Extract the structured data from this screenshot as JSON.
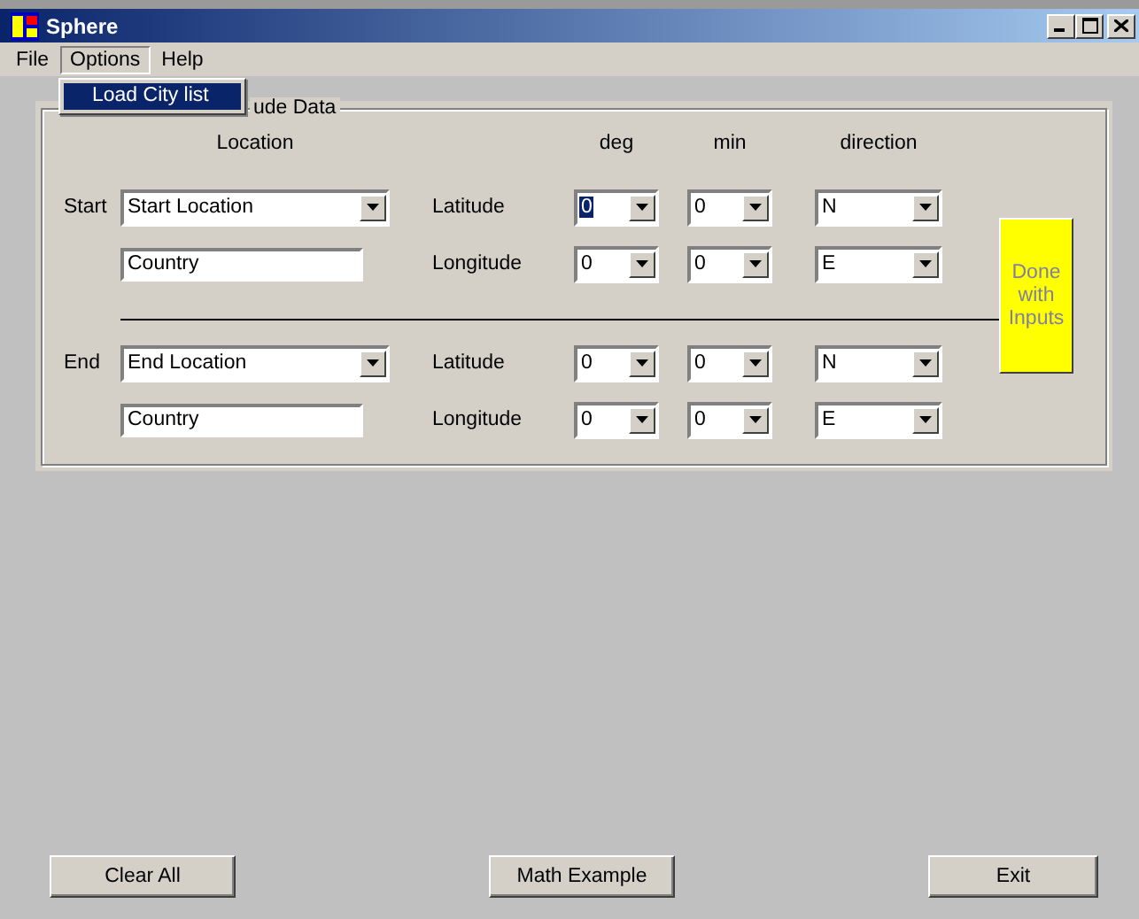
{
  "window": {
    "title": "Sphere"
  },
  "menu": [
    {
      "label": "File",
      "open": false
    },
    {
      "label": "Options",
      "open": true
    },
    {
      "label": "Help",
      "open": false
    }
  ],
  "dropdown_menu": [
    {
      "label": "Load City list",
      "selected": true
    }
  ],
  "group": {
    "legend": "ude Data"
  },
  "headers": {
    "location": "Location",
    "deg": "deg",
    "min": "min",
    "direction": "direction"
  },
  "sections": [
    {
      "label": "Start",
      "location": "Start Location",
      "country": "Country",
      "rows": [
        {
          "coord": "Latitude",
          "deg": "0",
          "deg_focused": true,
          "min": "0",
          "direction": "N"
        },
        {
          "coord": "Longitude",
          "deg": "0",
          "deg_focused": false,
          "min": "0",
          "direction": "E"
        }
      ]
    },
    {
      "label": "End",
      "location": "End Location",
      "country": "Country",
      "rows": [
        {
          "coord": "Latitude",
          "deg": "0",
          "deg_focused": false,
          "min": "0",
          "direction": "N"
        },
        {
          "coord": "Longitude",
          "deg": "0",
          "deg_focused": false,
          "min": "0",
          "direction": "E"
        }
      ]
    }
  ],
  "done_button": {
    "label": "Done with Inputs",
    "disabled": true
  },
  "buttons": [
    "Clear All",
    "Math Example",
    "Exit"
  ]
}
